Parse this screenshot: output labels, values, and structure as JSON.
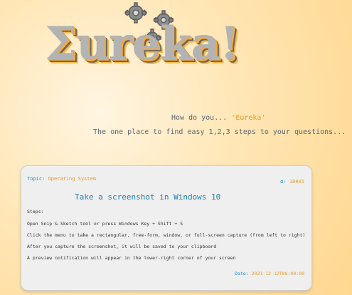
{
  "logo": {
    "text": "Σureka!",
    "gear_icon": "gear-icon",
    "colors": {
      "main": "#b3b3b3",
      "shadow_orange": "#f7a93d",
      "shadow_dark": "#6f6758"
    }
  },
  "header": {
    "question_prefix": "How do you... ",
    "question_brand": "'Eureka'",
    "subtitle": "The one place to find easy 1,2,3 steps to your questions..."
  },
  "card": {
    "topic_label": "Topic:",
    "topic_value": "Operating System",
    "id_label": "α:",
    "id_value": "10001",
    "title": "Take a screenshot in Windows 10",
    "steps_label": "Steps:",
    "steps": [
      "Open Snip & Sketch tool or press Windows Key + Shift + S",
      "Click the menu to take a rectangular, free-form, window, or full-screen capture (from left to right)",
      "After you capture the screenshot, it will be saved to your clipboard",
      "A preview notification will appear in the lower-right corner of your screen"
    ],
    "date_label": "Date:",
    "date_value": "2021-12-12T08:00:00"
  },
  "colors": {
    "label_blue": "#1d8ec3",
    "value_orange": "#e59b25",
    "title_blue": "#1d7fae",
    "brand_orange": "#e89a1c",
    "background_gradient": [
      "#fff5e1",
      "#ffe7b8",
      "#ffd78f"
    ],
    "card_background": "#efefef"
  }
}
